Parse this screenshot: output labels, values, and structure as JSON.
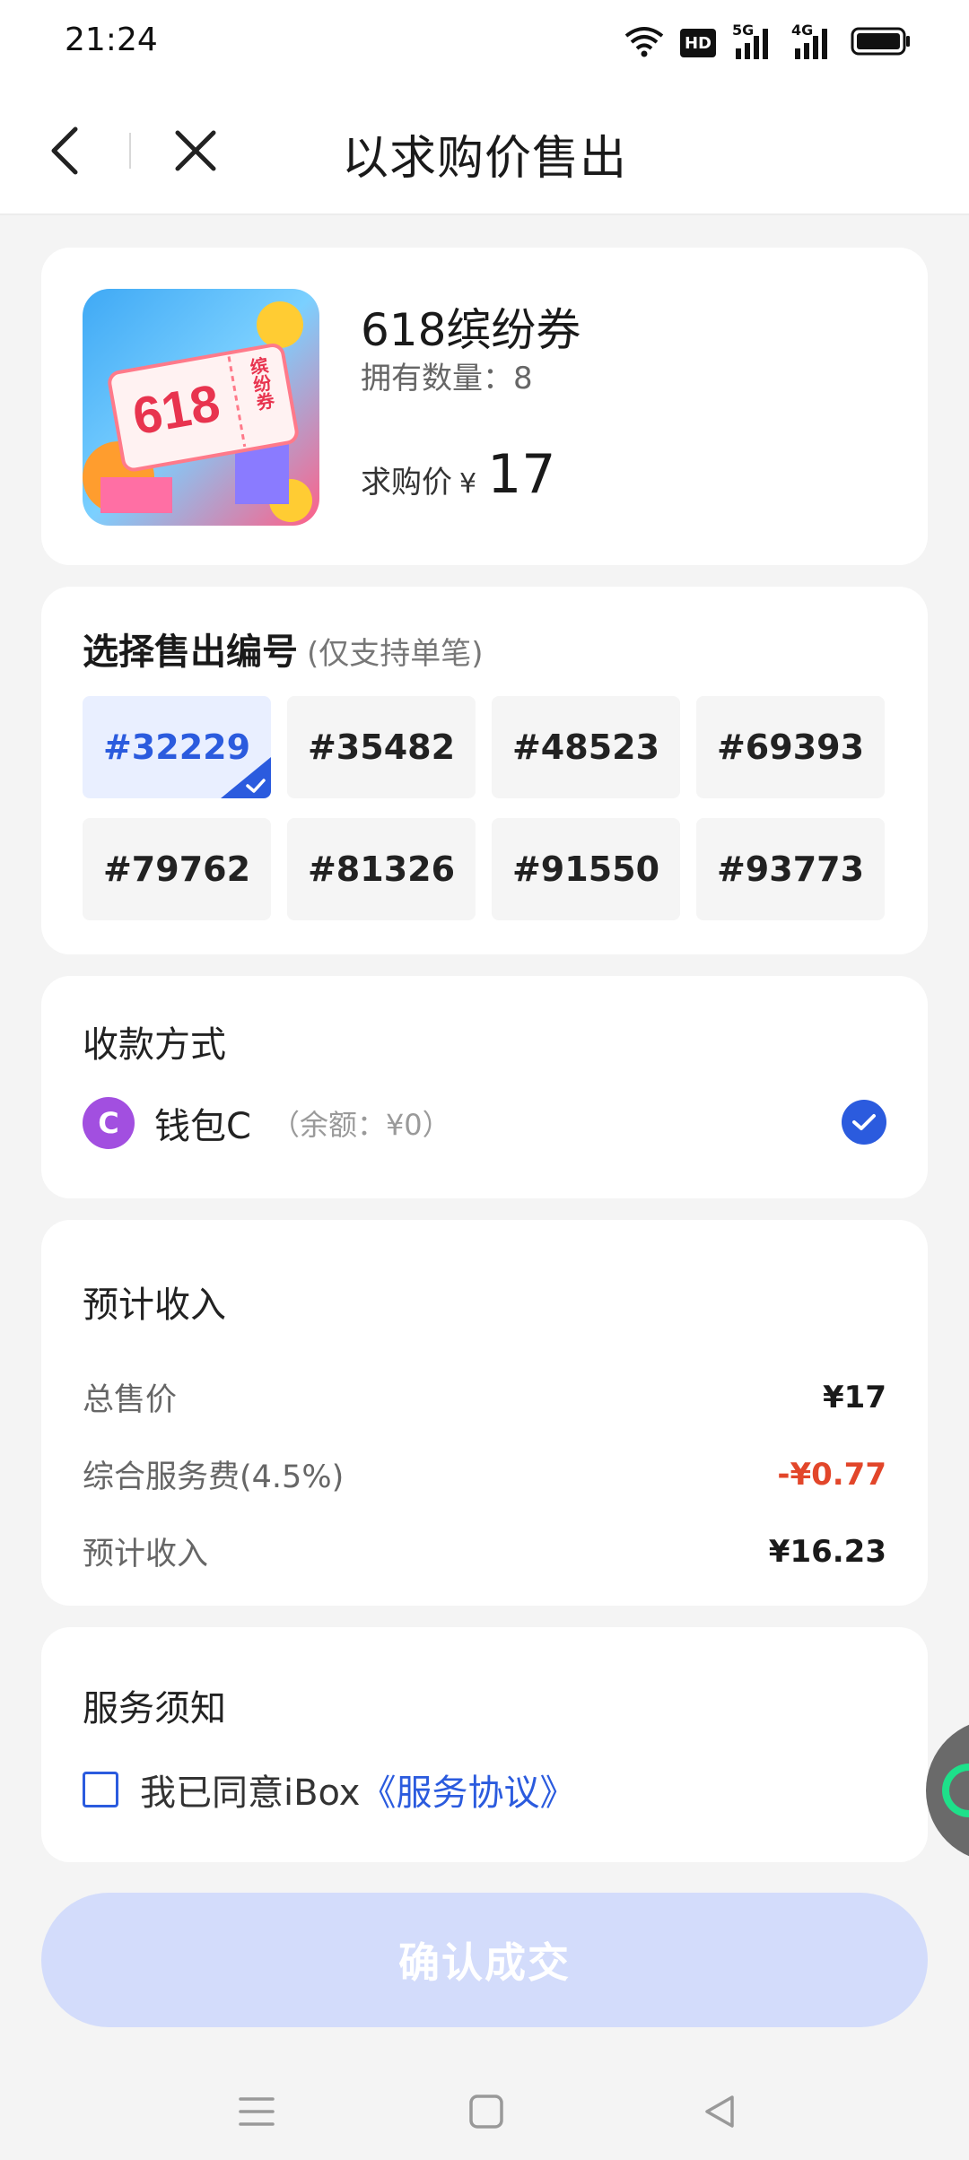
{
  "status_bar": {
    "time": "21:24",
    "icons": [
      "wifi-icon",
      "hd-icon",
      "5g-signal-icon",
      "4g-signal-icon",
      "battery-icon"
    ],
    "hd_label": "HD",
    "net1": "5G",
    "net2": "4G"
  },
  "nav": {
    "title": "以求购价售出"
  },
  "product": {
    "name": "618缤纷券",
    "quantity_text": "拥有数量：8",
    "bid_label": "求购价",
    "currency": "¥",
    "bid_price": "17",
    "thumb_text_618": "618",
    "thumb_text_ticket": "缤纷券"
  },
  "serial_section": {
    "title": "选择售出编号",
    "note": "(仅支持单笔)",
    "serials": [
      "#32229",
      "#35482",
      "#48523",
      "#69393",
      "#79762",
      "#81326",
      "#91550",
      "#93773"
    ],
    "selected_index": 0
  },
  "payment": {
    "title": "收款方式",
    "wallet_initial": "C",
    "wallet_name": "钱包C",
    "wallet_balance": "（余额：¥0）"
  },
  "income": {
    "title": "预计收入",
    "rows": [
      {
        "label": "总售价",
        "value": "¥17"
      },
      {
        "label": "综合服务费(4.5%)",
        "value": "-¥0.77"
      },
      {
        "label": "预计收入",
        "value": "¥16.23"
      }
    ]
  },
  "notice": {
    "title": "服务须知",
    "agree_text": "我已同意iBox",
    "agree_link": "《服务协议》"
  },
  "confirm_button": {
    "label": "确认成交"
  },
  "colors": {
    "accent": "#2b5bde",
    "fee": "#e2462a",
    "button_disabled": "#d3dcfb",
    "wallet_avatar": "#a24fe0"
  }
}
